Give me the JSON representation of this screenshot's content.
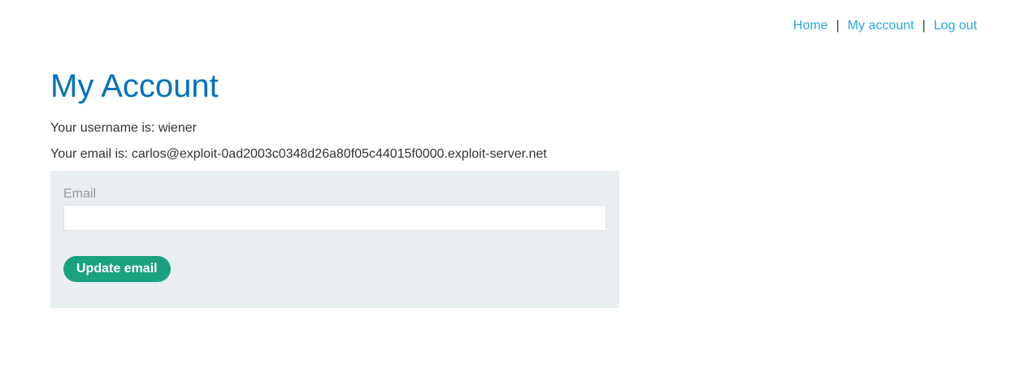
{
  "nav": {
    "home": "Home",
    "my_account": "My account",
    "log_out": "Log out",
    "separator": "|"
  },
  "page": {
    "title": "My Account",
    "username_line": "Your username is: wiener",
    "email_line": "Your email is: carlos@exploit-0ad2003c0348d26a80f05c44015f0000.exploit-server.net"
  },
  "form": {
    "email_label": "Email",
    "email_value": "",
    "submit_label": "Update email"
  },
  "colors": {
    "link": "#29a8e1",
    "title": "#0071bc",
    "panel_bg": "#e9eef1",
    "button_bg": "#1aa182"
  }
}
